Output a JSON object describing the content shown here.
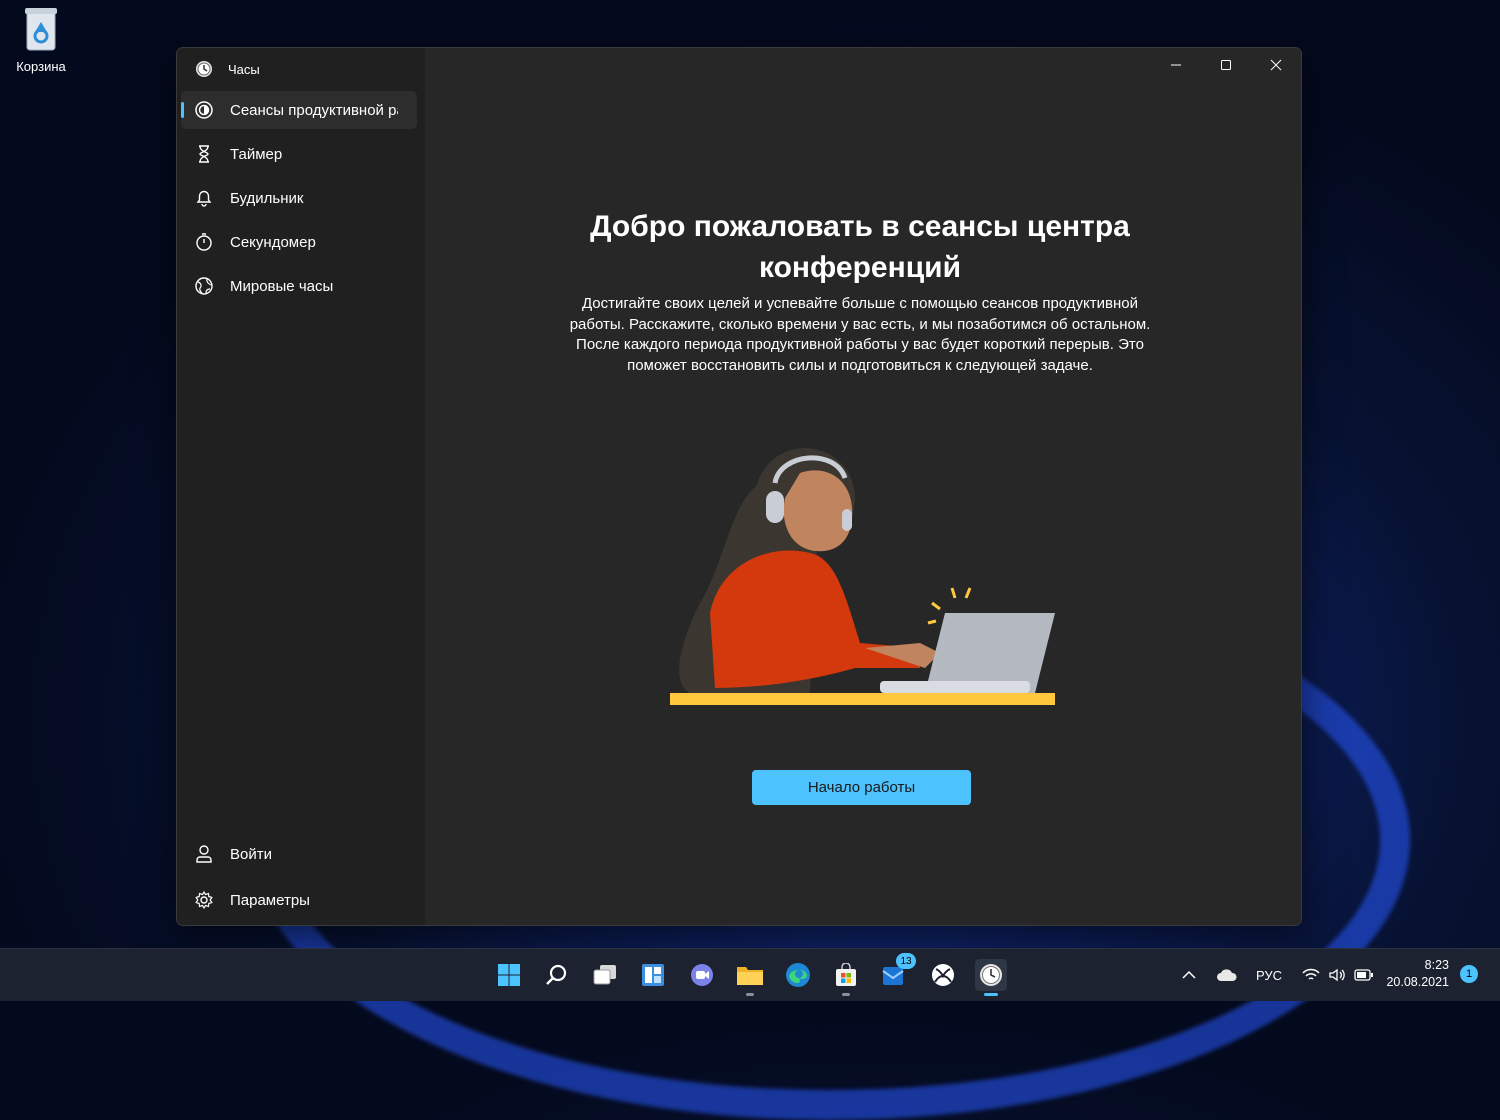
{
  "desktop": {
    "recycle_bin_label": "Корзина"
  },
  "window": {
    "app_title": "Часы",
    "controls": {
      "minimize": "—",
      "maximize": "☐",
      "close": "✕"
    }
  },
  "sidebar": {
    "items": [
      {
        "label": "Сеансы продуктивной работы",
        "icon": "focus-icon",
        "active": true
      },
      {
        "label": "Таймер",
        "icon": "hourglass-icon"
      },
      {
        "label": "Будильник",
        "icon": "bell-icon"
      },
      {
        "label": "Секундомер",
        "icon": "stopwatch-icon"
      },
      {
        "label": "Мировые часы",
        "icon": "globe-icon"
      }
    ],
    "bottom": [
      {
        "label": "Войти",
        "icon": "person-icon"
      },
      {
        "label": "Параметры",
        "icon": "gear-icon"
      }
    ]
  },
  "main": {
    "heading": "Добро пожаловать в сеансы центра конференций",
    "description": "Достигайте своих целей и успевайте больше с помощью сеансов продуктивной работы. Расскажите, сколько времени у вас есть, и мы позаботимся об остальном. После каждого периода продуктивной работы у вас будет короткий перерыв. Это поможет восстановить силы и подготовиться к следующей задаче.",
    "start_button": "Начало работы"
  },
  "taskbar": {
    "store_badge": "13",
    "language": "РУС",
    "time": "8:23",
    "date": "20.08.2021",
    "notifications": "1"
  },
  "colors": {
    "accent": "#4cc2ff",
    "window_bg": "#272727",
    "sidebar_bg": "#202020"
  }
}
